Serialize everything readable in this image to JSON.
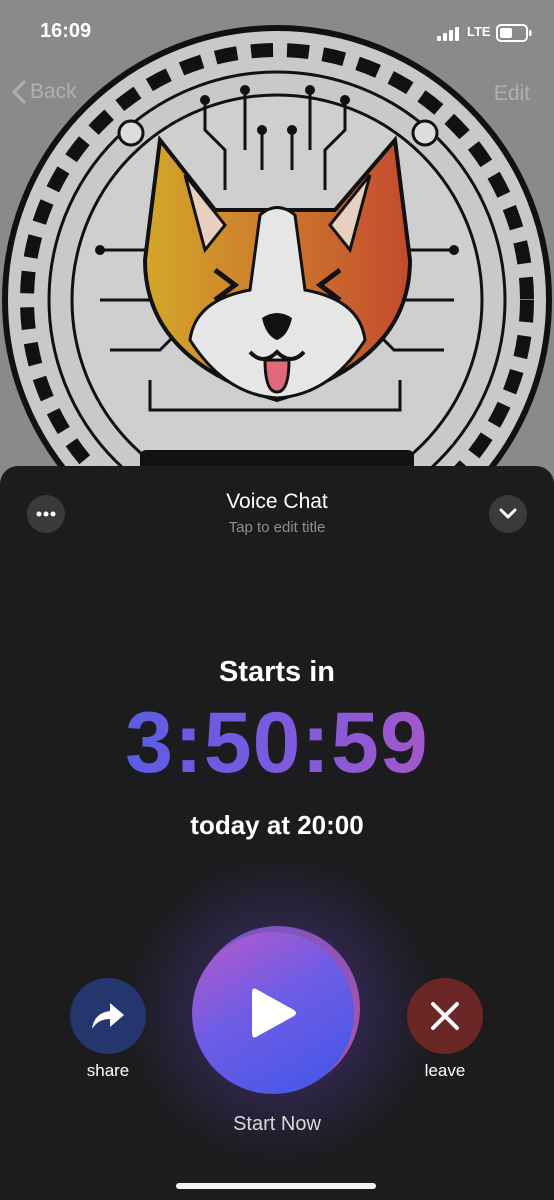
{
  "status_bar": {
    "time": "16:09",
    "carrier": "LTE"
  },
  "nav": {
    "back_label": "Back",
    "edit_label": "Edit"
  },
  "header": {
    "title": "Voice Chat",
    "subtitle": "Tap to edit title"
  },
  "countdown": {
    "heading": "Starts in",
    "timer": "3:50:59",
    "scheduled": "today at 20:00"
  },
  "actions": {
    "share_label": "share",
    "leave_label": "leave",
    "start_label": "Start Now"
  },
  "colors": {
    "share_bg": "#25356e",
    "leave_bg": "#6b2626",
    "timer_gradient_start": "#3d5fe8",
    "timer_gradient_end": "#c157b8"
  }
}
